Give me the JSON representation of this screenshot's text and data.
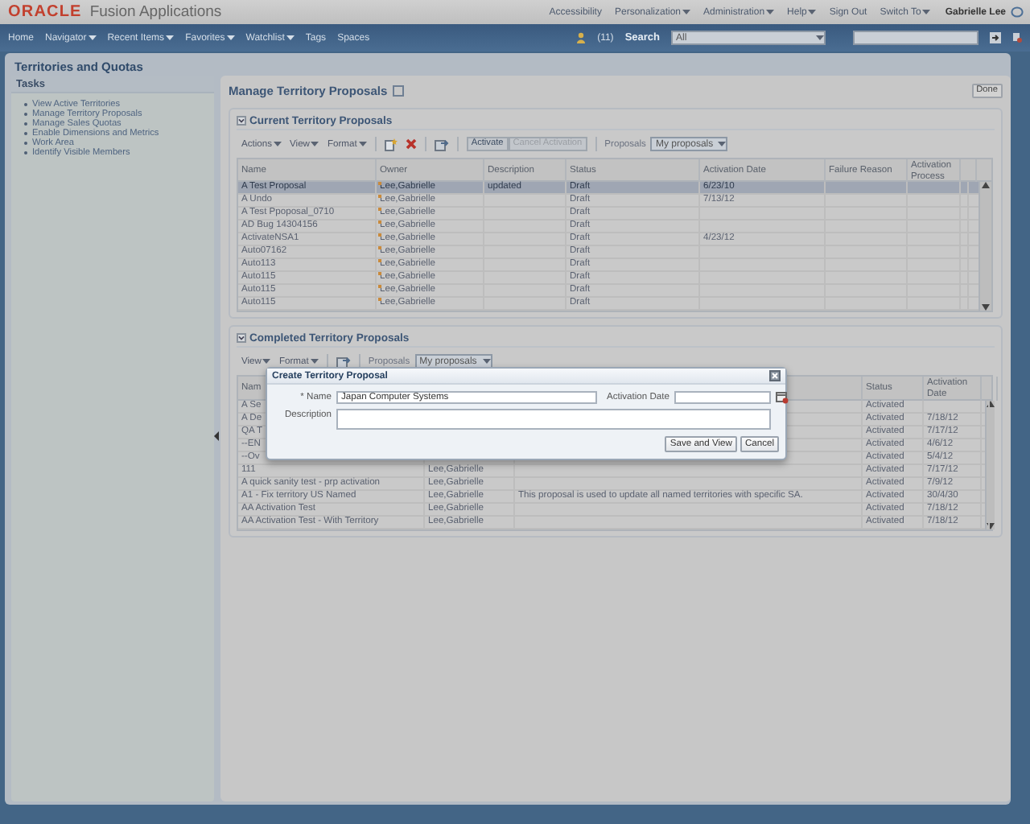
{
  "header": {
    "logo": "ORACLE",
    "product": "Fusion Applications",
    "links": [
      {
        "label": "Accessibility",
        "menu": false
      },
      {
        "label": "Personalization",
        "menu": true
      },
      {
        "label": "Administration",
        "menu": true
      },
      {
        "label": "Help",
        "menu": true
      },
      {
        "label": "Sign Out",
        "menu": false
      },
      {
        "label": "Switch To",
        "menu": true
      }
    ],
    "user": "Gabrielle Lee"
  },
  "nav": {
    "items": [
      {
        "label": "Home",
        "menu": false
      },
      {
        "label": "Navigator",
        "menu": true
      },
      {
        "label": "Recent Items",
        "menu": true
      },
      {
        "label": "Favorites",
        "menu": true
      },
      {
        "label": "Watchlist",
        "menu": true
      },
      {
        "label": "Tags",
        "menu": false
      },
      {
        "label": "Spaces",
        "menu": false
      }
    ],
    "notifications": "(11)",
    "search_label": "Search",
    "search_scope": "All"
  },
  "page_title": "Territories and Quotas",
  "tasks": {
    "title": "Tasks",
    "items": [
      "View Active Territories",
      "Manage Territory Proposals",
      "Manage Sales Quotas",
      "Enable Dimensions and Metrics",
      "Work Area",
      "Identify Visible Members"
    ]
  },
  "main": {
    "title": "Manage Territory Proposals",
    "done": "Done",
    "current": {
      "title": "Current Territory Proposals",
      "expanded": true,
      "menus": [
        "Actions",
        "View",
        "Format"
      ],
      "activate": "Activate",
      "cancel_activation": {
        "label": "Cancel Activation",
        "disabled": true
      },
      "proposals_label": "Proposals",
      "proposals_value": "My proposals",
      "columns": [
        "Name",
        "Owner",
        "Description",
        "Status",
        "Activation Date",
        "Failure Reason",
        "Activation Process"
      ],
      "rows": [
        {
          "name": "A Test Proposal",
          "owner": "Lee,Gabrielle",
          "description": "updated",
          "status": "Draft",
          "date": "6/23/10",
          "selected": true
        },
        {
          "name": "A Undo",
          "owner": "Lee,Gabrielle",
          "status": "Draft",
          "date": "7/13/12",
          "selected": false
        },
        {
          "name": "A Test Ppoposal_0710",
          "owner": "Lee,Gabrielle",
          "status": "Draft",
          "selected": false
        },
        {
          "name": "AD Bug 14304156",
          "owner": "Lee,Gabrielle",
          "status": "Draft",
          "selected": false
        },
        {
          "name": "ActivateNSA1",
          "owner": "Lee,Gabrielle",
          "status": "Draft",
          "date": "4/23/12",
          "selected": false
        },
        {
          "name": "Auto07162",
          "owner": "Lee,Gabrielle",
          "status": "Draft",
          "selected": false
        },
        {
          "name": "Auto113",
          "owner": "Lee,Gabrielle",
          "status": "Draft",
          "selected": false
        },
        {
          "name": "Auto115",
          "owner": "Lee,Gabrielle",
          "status": "Draft",
          "selected": false
        },
        {
          "name": "Auto115",
          "owner": "Lee,Gabrielle",
          "status": "Draft",
          "selected": false
        },
        {
          "name": "Auto115",
          "owner": "Lee,Gabrielle",
          "status": "Draft",
          "selected": false
        }
      ]
    },
    "completed": {
      "title": "Completed Territory Proposals",
      "expanded": true,
      "menus": [
        "View",
        "Format"
      ],
      "proposals_label": "Proposals",
      "proposals_value": "My proposals",
      "columns": [
        "Nam",
        "Status",
        "Activation Date"
      ],
      "rows": [
        {
          "name": "A Se",
          "status": "Activated",
          "selected": false
        },
        {
          "name": "A De",
          "status": "Activated",
          "date": "7/18/12",
          "selected": false
        },
        {
          "name": "QA T",
          "status": "Activated",
          "date": "7/17/12",
          "selected": false
        },
        {
          "name": "--EN",
          "status": "Activated",
          "date": "4/6/12",
          "selected": false
        },
        {
          "name": "--Ov",
          "status": "Activated",
          "date": "5/4/12",
          "selected": false
        },
        {
          "name": "111",
          "owner": "Lee,Gabrielle",
          "status": "Activated",
          "date": "7/17/12",
          "selected": false
        },
        {
          "name": "A quick sanity test - prp activation",
          "owner": "Lee,Gabrielle",
          "status": "Activated",
          "date": "7/9/12",
          "selected": false
        },
        {
          "name": "A1 - Fix territory US Named",
          "owner": "Lee,Gabrielle",
          "description": "This proposal is used to update all named territories with specific SA.",
          "status": "Activated",
          "date": "30/4/30",
          "selected": false
        },
        {
          "name": "AA Activation Test",
          "owner": "Lee,Gabrielle",
          "status": "Activated",
          "date": "7/18/12",
          "selected": false
        },
        {
          "name": "AA Activation Test - With Territory",
          "owner": "Lee,Gabrielle",
          "status": "Activated",
          "date": "7/18/12",
          "selected": false
        }
      ]
    }
  },
  "dialog": {
    "title": "Create Territory Proposal",
    "name_label": "* Name",
    "name_value": "Japan Computer Systems",
    "date_label": "Activation Date",
    "description_label": "Description",
    "buttons": [
      "Save and View",
      "Cancel"
    ]
  }
}
